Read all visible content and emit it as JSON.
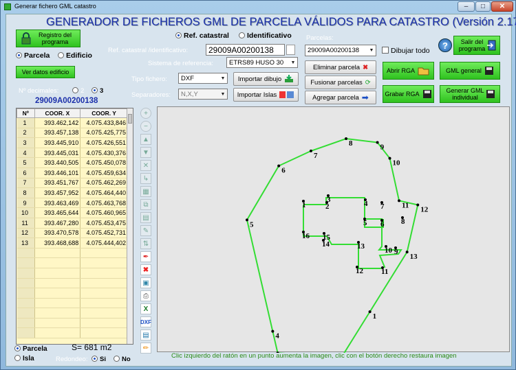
{
  "window": {
    "title": "Generar fichero GML catastro",
    "min": "–",
    "max": "□",
    "close": "✕"
  },
  "header": {
    "title": "GENERADOR DE FICHEROS GML DE PARCELA VÁLIDOS PARA CATASTRO (Versión  2.17)"
  },
  "left": {
    "registro_label": "Registro del programa",
    "radio_parcela": "Parcela",
    "radio_edificio": "Edificio",
    "ver_datos": "Ver datos edificio",
    "decimales_label": "Nº decimales:",
    "dec_2": "2",
    "dec_3": "3",
    "refcat": "29009A00200138"
  },
  "form": {
    "radio_ref": "Ref. catastral",
    "radio_ident": "Identificativo",
    "ref_label": "Ref. catastral /identificativo:",
    "ref_value": "29009A00200138",
    "sistema_label": "Sistema de referencia:",
    "sistema_value": "ETRS89 HUSO 30",
    "tipo_label": "Tipo fichero:",
    "tipo_value": "DXF",
    "sep_label": "Separadores:",
    "sep_value": "N,X,Y",
    "importar_dibujo": "Importar dibujo",
    "importar_islas": "Importar Islas"
  },
  "parcelas": {
    "label": "Parcelas:",
    "value": "29009A00200138",
    "dibujar_todo": "Dibujar todo",
    "eliminar": "Eliminar parcela",
    "fusionar": "Fusionar parcelas",
    "agregar": "Agregar parcela"
  },
  "actions": {
    "help": "?",
    "salir": "Salir del programa",
    "abrir_rga": "Abrir RGA",
    "gml_general": "GML general",
    "grabar_rga": "Grabar RGA",
    "gml_individual": "Generar GML individual"
  },
  "table": {
    "headers": [
      "Nº",
      "COOR. X",
      "COOR. Y"
    ],
    "rows": [
      [
        "1",
        "393.462,142",
        "4.075.433,846"
      ],
      [
        "2",
        "393.457,138",
        "4.075.425,775"
      ],
      [
        "3",
        "393.445,910",
        "4.075.426,551"
      ],
      [
        "4",
        "393.445,031",
        "4.075.430,376"
      ],
      [
        "5",
        "393.440,505",
        "4.075.450,078"
      ],
      [
        "6",
        "393.446,101",
        "4.075.459,634"
      ],
      [
        "7",
        "393.451,767",
        "4.075.462,269"
      ],
      [
        "8",
        "393.457,952",
        "4.075.464,440"
      ],
      [
        "9",
        "393.463,469",
        "4.075.463,768"
      ],
      [
        "10",
        "393.465,644",
        "4.075.460,965"
      ],
      [
        "11",
        "393.467,280",
        "4.075.453,475"
      ],
      [
        "12",
        "393.470,578",
        "4.075.452,731"
      ],
      [
        "13",
        "393.468,688",
        "4.075.444,402"
      ]
    ],
    "empty_rows": 9
  },
  "bottom": {
    "radio_parcela": "Parcela",
    "radio_isla": "Isla",
    "area": "S= 681 m2",
    "redondeo_label": "Redondeo:",
    "si": "Si",
    "no": "No",
    "hint": "Clic izquierdo del ratón en un punto aumenta la imagen, clic con el botón derecho restaura imagen"
  },
  "colors": {
    "accent": "#1b2faa",
    "button_green": "#35c224",
    "polygon": "#33dd33",
    "label_white": "#ffffff",
    "hint": "#2a8a15"
  },
  "drawing": {
    "outer": [
      {
        "n": "1",
        "x": 393462.142,
        "y": 4075433.846
      },
      {
        "n": "2",
        "x": 393457.138,
        "y": 4075425.775
      },
      {
        "n": "3",
        "x": 393445.91,
        "y": 4075426.551
      },
      {
        "n": "4",
        "x": 393445.031,
        "y": 4075430.376
      },
      {
        "n": "5",
        "x": 393440.505,
        "y": 4075450.078
      },
      {
        "n": "6",
        "x": 393446.101,
        "y": 4075459.634
      },
      {
        "n": "7",
        "x": 393451.767,
        "y": 4075462.269
      },
      {
        "n": "8",
        "x": 393457.952,
        "y": 4075464.44
      },
      {
        "n": "9",
        "x": 393463.469,
        "y": 4075463.768
      },
      {
        "n": "10",
        "x": 393465.644,
        "y": 4075460.965
      },
      {
        "n": "11",
        "x": 393467.28,
        "y": 4075453.475
      },
      {
        "n": "12",
        "x": 393470.578,
        "y": 4075452.731
      },
      {
        "n": "13",
        "x": 393468.688,
        "y": 4075444.402
      }
    ],
    "inner_labels": [
      "1",
      "2",
      "3",
      "4",
      "5",
      "6",
      "7",
      "8",
      "9",
      "10",
      "11",
      "12",
      "13",
      "14",
      "15",
      "16"
    ]
  }
}
